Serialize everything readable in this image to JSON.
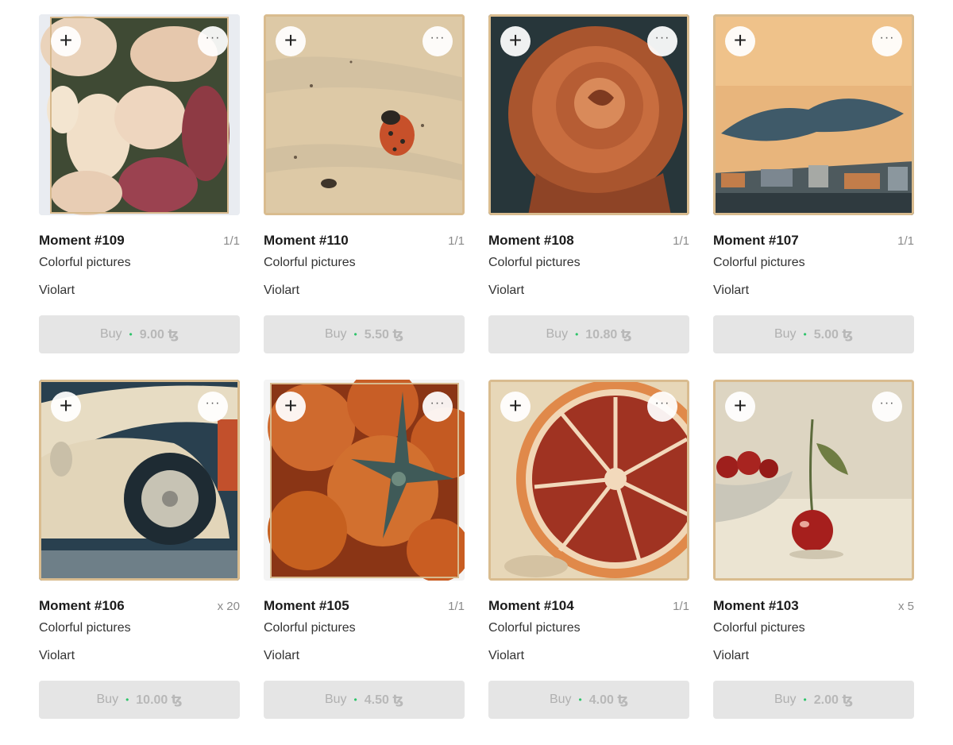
{
  "accent": {
    "available_dot": "#2fc46b",
    "button_bg": "#e5e5e5"
  },
  "icons": {
    "add": "plus-icon",
    "more": "more-dots-icon"
  },
  "add_glyph": "+",
  "more_glyph": "···",
  "dot_glyph": "•",
  "cards": [
    {
      "title": "Moment #109",
      "edition": "1/1",
      "collection": "Colorful pictures",
      "artist": "Violart",
      "buy_label": "Buy",
      "price": "9.00 ꜩ",
      "image": "garlic-cloves"
    },
    {
      "title": "Moment #110",
      "edition": "1/1",
      "collection": "Colorful pictures",
      "artist": "Violart",
      "buy_label": "Buy",
      "price": "5.50 ꜩ",
      "image": "ladybug"
    },
    {
      "title": "Moment #108",
      "edition": "1/1",
      "collection": "Colorful pictures",
      "artist": "Violart",
      "buy_label": "Buy",
      "price": "10.80 ꜩ",
      "image": "rose"
    },
    {
      "title": "Moment #107",
      "edition": "1/1",
      "collection": "Colorful pictures",
      "artist": "Violart",
      "buy_label": "Buy",
      "price": "5.00 ꜩ",
      "image": "sunset-city"
    },
    {
      "title": "Moment #106",
      "edition": "x 20",
      "collection": "Colorful pictures",
      "artist": "Violart",
      "buy_label": "Buy",
      "price": "10.00 ꜩ",
      "image": "vintage-car"
    },
    {
      "title": "Moment #105",
      "edition": "1/1",
      "collection": "Colorful pictures",
      "artist": "Violart",
      "buy_label": "Buy",
      "price": "4.50 ꜩ",
      "image": "tomatoes"
    },
    {
      "title": "Moment #104",
      "edition": "1/1",
      "collection": "Colorful pictures",
      "artist": "Violart",
      "buy_label": "Buy",
      "price": "4.00 ꜩ",
      "image": "blood-orange"
    },
    {
      "title": "Moment #103",
      "edition": "x 5",
      "collection": "Colorful pictures",
      "artist": "Violart",
      "buy_label": "Buy",
      "price": "2.00 ꜩ",
      "image": "cherries"
    }
  ]
}
